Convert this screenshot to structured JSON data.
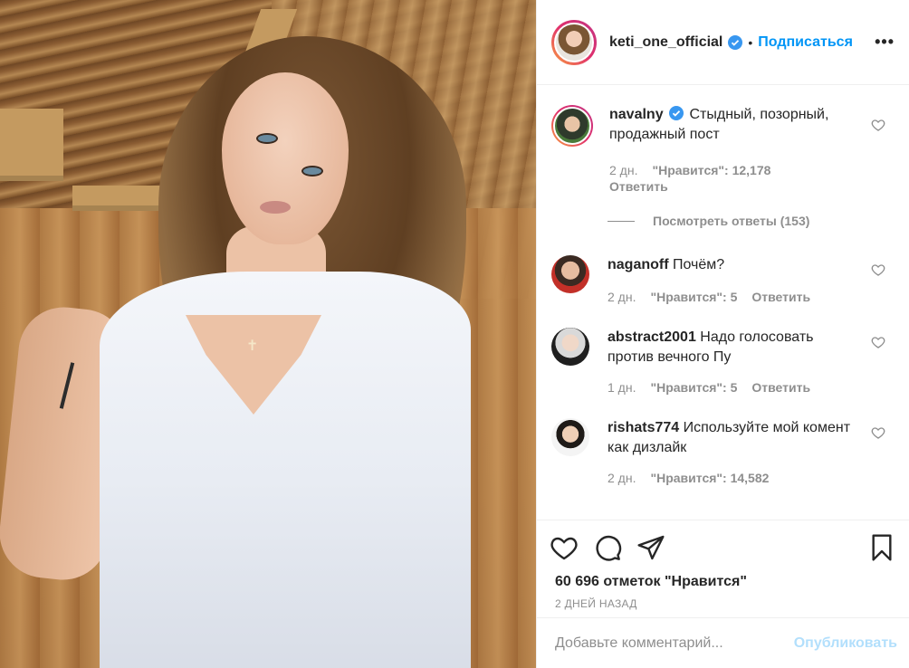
{
  "header": {
    "username": "keti_one_official",
    "verified": true,
    "separator": "•",
    "follow_label": "Подписаться",
    "more_label": "•••"
  },
  "comments": [
    {
      "username": "navalny",
      "verified": true,
      "text": "Стыдный, позорный, продажный пост",
      "time": "2 дн.",
      "likes": "\"Нравится\": 12,178",
      "reply_label": "Ответить",
      "view_replies": "Посмотреть ответы (153)"
    },
    {
      "username": "naganoff",
      "text": "Почём?",
      "time": "2 дн.",
      "likes": "\"Нравится\": 5",
      "reply_label": "Ответить"
    },
    {
      "username": "abstract2001",
      "text": "Надо голосовать против вечного Пу",
      "time": "1 дн.",
      "likes": "\"Нравится\": 5",
      "reply_label": "Ответить"
    },
    {
      "username": "rishats774",
      "text": "Используйте мой комент как дизлайк",
      "time": "2 дн.",
      "likes": "\"Нравится\": 14,582"
    }
  ],
  "actions": {
    "like_icon": "heart-icon",
    "comment_icon": "speech-bubble-icon",
    "share_icon": "paper-plane-icon",
    "save_icon": "bookmark-icon"
  },
  "likes_count": "60 696 отметок \"Нравится\"",
  "posted_ago": "2 ДНЕЙ НАЗАД",
  "add_comment": {
    "placeholder": "Добавьте комментарий...",
    "post_label": "Опубликовать"
  },
  "colors": {
    "accent": "#0095f6",
    "post_disabled": "#b2dffc",
    "muted": "#8e8e8e"
  }
}
